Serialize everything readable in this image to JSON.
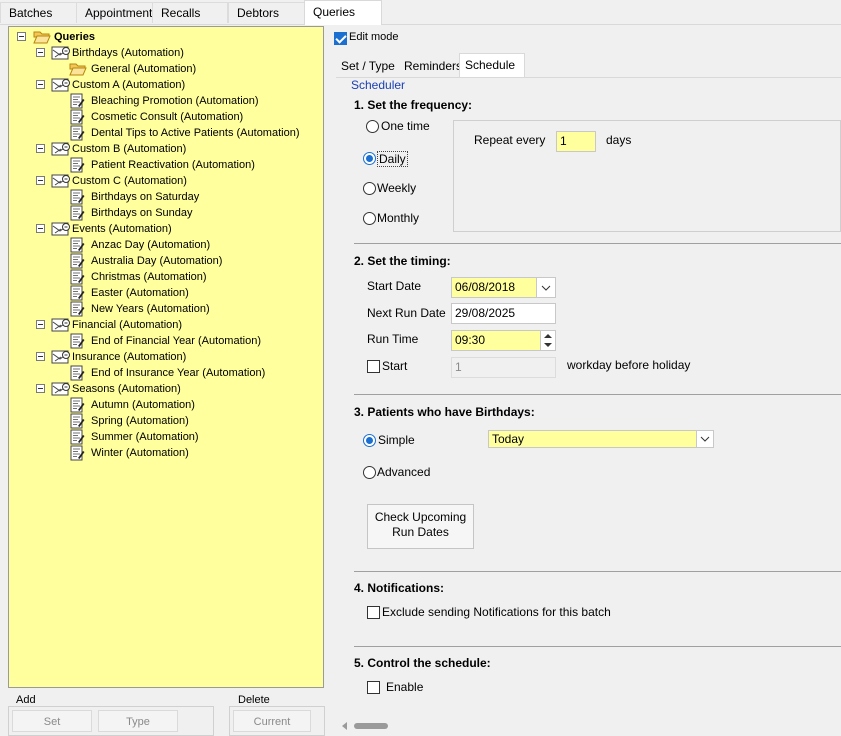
{
  "top_tabs": [
    "Batches",
    "Appointments",
    "Recalls",
    "Debtors",
    "Queries"
  ],
  "tree": {
    "root": "Queries",
    "groups": [
      {
        "label": "Birthdays (Automation)",
        "children": [
          "General (Automation)"
        ]
      },
      {
        "label": "Custom A (Automation)",
        "children": [
          "Bleaching Promotion (Automation)",
          "Cosmetic Consult (Automation)",
          "Dental Tips to Active Patients (Automation)"
        ]
      },
      {
        "label": "Custom B (Automation)",
        "children": [
          "Patient Reactivation (Automation)"
        ]
      },
      {
        "label": "Custom C (Automation)",
        "children": [
          "Birthdays on Saturday",
          "Birthdays on Sunday"
        ]
      },
      {
        "label": "Events (Automation)",
        "children": [
          "Anzac Day (Automation)",
          "Australia Day (Automation)",
          "Christmas (Automation)",
          "Easter (Automation)",
          "New Years (Automation)"
        ]
      },
      {
        "label": "Financial (Automation)",
        "children": [
          "End of Financial Year (Automation)"
        ]
      },
      {
        "label": "Insurance (Automation)",
        "children": [
          "End of Insurance Year (Automation)"
        ]
      },
      {
        "label": "Seasons (Automation)",
        "children": [
          "Autumn (Automation)",
          "Spring (Automation)",
          "Summer (Automation)",
          "Winter (Automation)"
        ]
      }
    ]
  },
  "add_group": {
    "title": "Add",
    "set": "Set",
    "type": "Type"
  },
  "delete_group": {
    "title": "Delete",
    "current": "Current"
  },
  "edit_mode": "Edit mode",
  "sub_tabs": [
    "Set / Type",
    "Reminders",
    "Schedule"
  ],
  "scheduler": {
    "title": "Scheduler",
    "freq_heading": "1. Set the frequency:",
    "freq_options": [
      "One time",
      "Daily",
      "Weekly",
      "Monthly"
    ],
    "repeat_label": "Repeat every",
    "repeat_value": "1",
    "repeat_unit": "days",
    "timing_heading": "2. Set the timing:",
    "start_date_label": "Start Date",
    "start_date": "06/08/2018",
    "next_run_label": "Next Run Date",
    "next_run": "29/08/2025",
    "run_time_label": "Run Time",
    "run_time": "09:30",
    "start_label": "Start",
    "start_days": "1",
    "workday_label": "workday before holiday",
    "patients_heading": "3. Patients who have Birthdays:",
    "simple_label": "Simple",
    "simple_value": "Today",
    "advanced_label": "Advanced",
    "check_button_l1": "Check Upcoming",
    "check_button_l2": "Run Dates",
    "notif_heading": "4. Notifications:",
    "exclude_label": "Exclude sending Notifications for this batch",
    "control_heading": "5. Control the schedule:",
    "enable_label": "Enable"
  },
  "colors": {
    "tree_bg": "#ffff9e",
    "accent": "#1a6fd1",
    "heading_blue": "#1a3fb5"
  }
}
